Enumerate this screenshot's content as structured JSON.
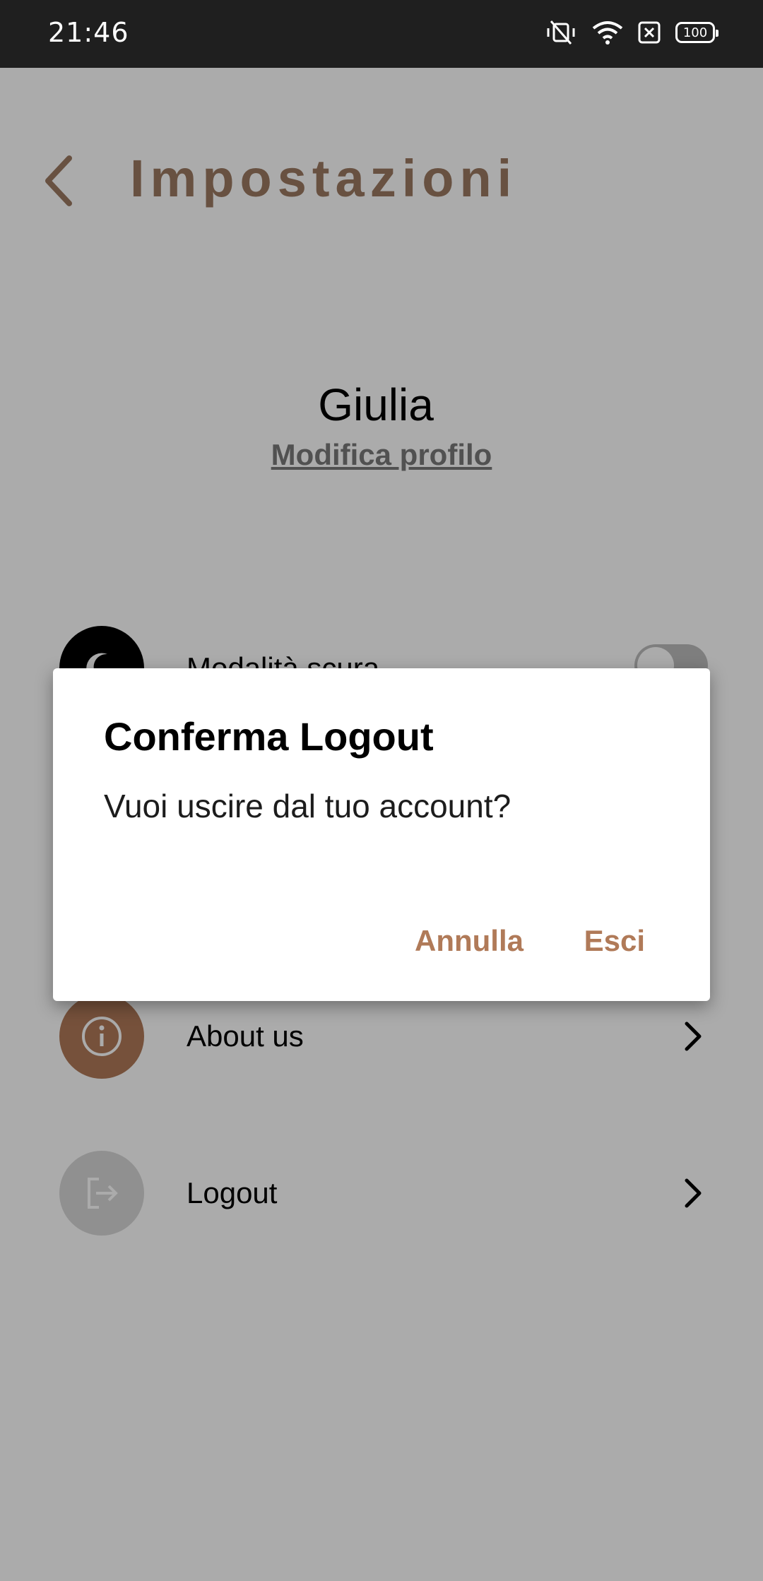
{
  "status_bar": {
    "time": "21:46",
    "battery": "100",
    "icons": [
      "vibrate-icon",
      "wifi-icon",
      "sim-off-icon",
      "battery-icon"
    ]
  },
  "header": {
    "title": "Impostazioni",
    "back_icon": "chevron-left-icon"
  },
  "profile": {
    "name": "Giulia",
    "edit_link": "Modifica profilo"
  },
  "settings": [
    {
      "label": "Modalità scura",
      "icon": "moon-icon",
      "icon_bg": "#000000",
      "control": "toggle",
      "enabled": false
    },
    {
      "label": "About us",
      "icon": "info-icon",
      "icon_bg": "#b07a58",
      "control": "chevron"
    },
    {
      "label": "Logout",
      "icon": "logout-icon",
      "icon_bg": "#d7d7d7",
      "control": "chevron"
    }
  ],
  "dialog": {
    "title": "Conferma Logout",
    "message": "Vuoi uscire dal tuo account?",
    "cancel_label": "Annulla",
    "confirm_label": "Esci"
  },
  "colors": {
    "accent": "#b07a58",
    "title": "#9c7a62",
    "status_bar": "#1f1f1f"
  }
}
